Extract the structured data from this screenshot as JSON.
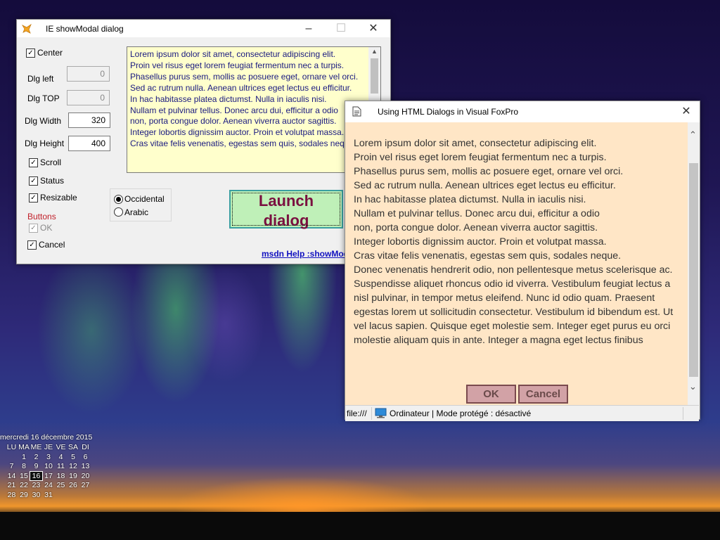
{
  "dialog1": {
    "title": "IE showModal dialog",
    "center_label": "Center",
    "dlg_left_label": "Dlg left",
    "dlg_left_value": "0",
    "dlg_top_label": "Dlg TOP",
    "dlg_top_value": "0",
    "dlg_width_label": "Dlg Width",
    "dlg_width_value": "320",
    "dlg_height_label": "Dlg Height",
    "dlg_height_value": "400",
    "scroll_label": "Scroll",
    "status_label": "Status",
    "resizable_label": "Resizable",
    "buttons_label": "Buttons",
    "ok_label": "OK",
    "cancel_label": "Cancel",
    "occidental_label": "Occidental",
    "arabic_label": "Arabic",
    "launch_line1": "Launch",
    "launch_line2": "dialog",
    "msdn_link": "msdn Help :showModalDialog",
    "memo_text": "Lorem ipsum dolor sit amet, consectetur adipiscing elit.\nProin vel risus eget lorem feugiat fermentum nec a turpis.\nPhasellus purus sem, mollis ac posuere eget, ornare vel orci.\nSed ac rutrum nulla. Aenean ultrices eget lectus eu efficitur.\nIn hac habitasse platea dictumst. Nulla in iaculis nisi.\nNullam et pulvinar tellus. Donec arcu dui, efficitur a odio\nnon, porta congue dolor. Aenean viverra auctor sagittis.\nInteger lobortis dignissim auctor. Proin et volutpat massa.\nCras vitae felis venenatis, egestas sem quis, sodales neque.",
    "accent_color": "#7a1040"
  },
  "dialog2": {
    "title": "Using HTML Dialogs in Visual FoxPro",
    "body_text": "Lorem ipsum dolor sit amet, consectetur adipiscing elit.\nProin vel risus eget lorem feugiat fermentum nec a turpis.\nPhasellus purus sem, mollis ac posuere eget, ornare vel orci.\nSed ac rutrum nulla. Aenean ultrices eget lectus eu efficitur.\nIn hac habitasse platea dictumst. Nulla in iaculis nisi.\nNullam et pulvinar tellus. Donec arcu dui, efficitur a odio\nnon, porta congue dolor. Aenean viverra auctor sagittis.\nInteger lobortis dignissim auctor. Proin et volutpat massa.\nCras vitae felis venenatis, egestas sem quis, sodales neque.\nDonec venenatis hendrerit odio, non pellentesque metus scelerisque ac.\nSuspendisse aliquet rhoncus odio id viverra. Vestibulum feugiat lectus a nisl pulvinar, in tempor metus eleifend. Nunc id odio quam. Praesent egestas lorem ut sollicitudin consectetur. Vestibulum id bibendum est. Ut vel lacus sapien. Quisque eget molestie sem. Integer eget purus eu orci molestie aliquam quis in ante. Integer a magna eget lectus finibus",
    "ok_label": "OK",
    "cancel_label": "Cancel",
    "status_file": "file:///",
    "status_zone": "Ordinateur | Mode protégé : désactivé",
    "background_color": "#ffe6c6"
  },
  "calendar": {
    "header": "mercredi 16 décembre 2015",
    "weekdays": [
      "LU",
      "MA",
      "ME",
      "JE",
      "VE",
      "SA",
      "DI"
    ],
    "rows": [
      [
        "",
        "",
        "1",
        "2",
        "3",
        "4",
        "5",
        "6"
      ],
      [
        "7",
        "8",
        "9",
        "10",
        "11",
        "12",
        "13"
      ],
      [
        "14",
        "15",
        "16",
        "17",
        "18",
        "19",
        "20"
      ],
      [
        "21",
        "22",
        "23",
        "24",
        "25",
        "26",
        "27"
      ],
      [
        "28",
        "29",
        "30",
        "31"
      ]
    ],
    "today": "16"
  }
}
